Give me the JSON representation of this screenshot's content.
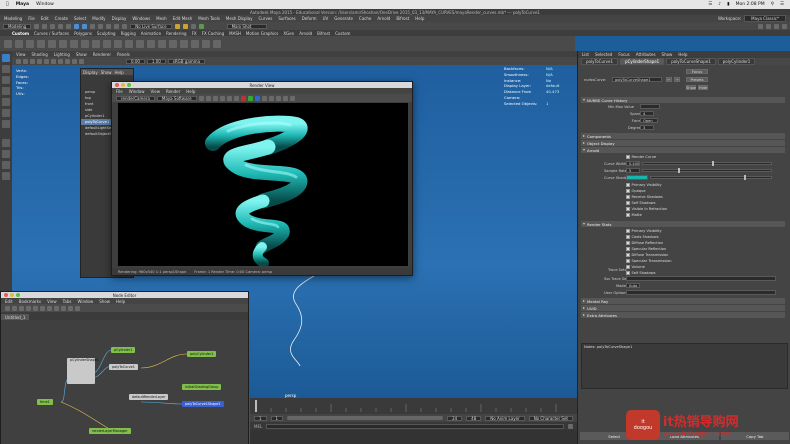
{
  "macbar": {
    "apple": "",
    "app": "Maya",
    "menu": "Window",
    "time": "Mon 2:08 PM",
    "status_icons": [
      "wifi-icon",
      "volume-icon",
      "battery-icon",
      "search-icon",
      "list-icon"
    ]
  },
  "title": "Autodesk Maya 2015 - Educational Version: /Users/amirShoshan/OneDrive 2015_03_13/MAYA_CURVES/mayaRender_curves.mb* --- polyToCurve1",
  "main_menu": [
    "Modeling",
    "File",
    "Edit",
    "Create",
    "Select",
    "Modify",
    "Display",
    "Windows",
    "Mesh",
    "Edit Mesh",
    "Mesh Tools",
    "Mesh Display",
    "Curves",
    "Surfaces",
    "Deform",
    "UV",
    "Generate",
    "Cache",
    "Arnold",
    "Bifrost",
    "Help"
  ],
  "workspace": {
    "label": "Workspace:",
    "value": "Maya Classic*"
  },
  "status": {
    "mode": "Modeling",
    "live": "No Live Surface",
    "field1": "",
    "render_field": "Main Shot"
  },
  "shelf_tabs": [
    "Custom",
    "Curves / Surfaces",
    "Polygons",
    "Sculpting",
    "Rigging",
    "Animation",
    "Rendering",
    "FX",
    "FX Caching",
    "MASH",
    "Motion Graphics",
    "XGen",
    "Arnold",
    "Bifrost",
    "Custom"
  ],
  "viewport": {
    "menu": [
      "View",
      "Shading",
      "Lighting",
      "Show",
      "Renderer",
      "Panels"
    ],
    "zoom": "0.00",
    "scale": "1.00",
    "color_space": "sRGB gamma",
    "hud_left": [
      "Verts:",
      "Edges:",
      "Faces:",
      "Tris:",
      "UVs:"
    ],
    "hud_right": [
      [
        "Backfaces:",
        "N/A"
      ],
      [
        "Smoothness:",
        "N/A"
      ],
      [
        "Instance:",
        "No"
      ],
      [
        "Display Layer:",
        "default"
      ],
      [
        "Distance From Camera:",
        "40.473"
      ],
      [
        "Selected Objects:",
        "1"
      ]
    ],
    "camera": "persp"
  },
  "outliner": {
    "menu": [
      "Display",
      "Show",
      "Help"
    ],
    "items": [
      "persp",
      "top",
      "front",
      "side",
      "pCylinder1",
      "polyToCurve1",
      "defaultLightSet",
      "defaultObjectSet"
    ]
  },
  "render_view": {
    "title": "Render View",
    "menu": [
      "File",
      "Window",
      "View",
      "Render",
      "Help"
    ],
    "camera": "renderCamera",
    "renderer": "Maya Software",
    "status": "Rendering: 960x540 1:1  persp1Shape",
    "time": "Frame: 1  Render Time: 0:00  Camera: persp"
  },
  "node_editor": {
    "title": "Node Editor",
    "menu": [
      "Edit",
      "Bookmarks",
      "View",
      "Tabs",
      "Window",
      "Show",
      "Help"
    ],
    "tab": "Untitled_1",
    "nodes": [
      {
        "label": "pCylinder1",
        "color": "#7fbf4a"
      },
      {
        "label": "pCylinderShape1",
        "color": "#c9c9c9"
      },
      {
        "label": "polyToCurve1",
        "color": "#c9c9c9"
      },
      {
        "label": "polyCylinder1",
        "color": "#7fbf4a"
      },
      {
        "label": "time1",
        "color": "#7fbf4a"
      },
      {
        "label": "polyToCurve1Shape1",
        "color": "#3a5fd0"
      },
      {
        "label": "initialShadingGroup",
        "color": "#7fbf4a"
      },
      {
        "label": "defaultRenderLayer",
        "color": "#c9c9c9"
      },
      {
        "label": "renderLayerManager",
        "color": "#7fbf4a"
      }
    ]
  },
  "timeline": {
    "ticks": [
      "1",
      "",
      "",
      "",
      "",
      "",
      "",
      "",
      "",
      "",
      "",
      "",
      "",
      "",
      "",
      "",
      "",
      "",
      "",
      "",
      "24"
    ],
    "start": "1",
    "end": "24",
    "range_end": "48",
    "anim_layer": "No Anim Layer",
    "char_set": "No Character Set"
  },
  "attribute_editor": {
    "menu": [
      "List",
      "Selected",
      "Focus",
      "Attributes",
      "Show",
      "Help"
    ],
    "node_tabs": [
      "polyToCurve1",
      "pCylinderShape1",
      "polyToCurveShape1",
      "polyCylinder1",
      "initialShadingGroup"
    ],
    "node_label": "nurbsCurve:",
    "node_value": "polyToCurveShape1",
    "focus_btn": "Focus",
    "presets_btn": "Presets",
    "show_btn": "Show",
    "hide_btn": "Hide",
    "sections": [
      {
        "label": "NURBS Curve History",
        "open": true
      },
      {
        "label": "Components",
        "open": false
      },
      {
        "label": "Object Display",
        "open": false
      },
      {
        "label": "Arnold",
        "open": true
      },
      {
        "label": "Render Stats",
        "open": true
      },
      {
        "label": "Mental Ray",
        "open": false
      },
      {
        "label": "UUID",
        "open": false
      },
      {
        "label": "Extra Attributes",
        "open": false
      }
    ],
    "history": {
      "min_max": "Min Max Value",
      "spans_label": "Spans",
      "spans_value": "4",
      "form_label": "Form",
      "form_value": "Open",
      "degree_label": "Degree",
      "degree_value": "3"
    },
    "arnold": {
      "render_curve": "Render Curve",
      "curve_width_label": "Curve Width",
      "curve_width": "0.400",
      "sample_rate_label": "Sample Rate",
      "sample_rate": "5",
      "curve_shader_label": "Curve Shader",
      "checks": [
        "Primary Visibility",
        "Opaque",
        "Receive Shadows",
        "Self Shadows",
        "Visible In Refraction",
        "Matte"
      ]
    },
    "render_stats": {
      "checks": [
        "Primary Visibility",
        "Casts Shadows",
        "Diffuse Reflection",
        "Specular Reflection",
        "Diffuse Transmission",
        "Specular Transmission",
        "Volume",
        "Self Shadows"
      ],
      "trace_sets_label": "Trace Sets",
      "sss_set_label": "Sss Trace Set",
      "mode_label": "Mode",
      "mode_value": "Auto",
      "user_options_label": "User Options"
    },
    "notes_label": "Notes:  polyToCurveShape1",
    "buttons": [
      "Select",
      "Load Attributes",
      "Copy Tab"
    ]
  },
  "watermark": {
    "logo_top": "it",
    "logo_bottom": "doogou",
    "text": "it热销导购网",
    "url": "www.itdaogou.com"
  }
}
